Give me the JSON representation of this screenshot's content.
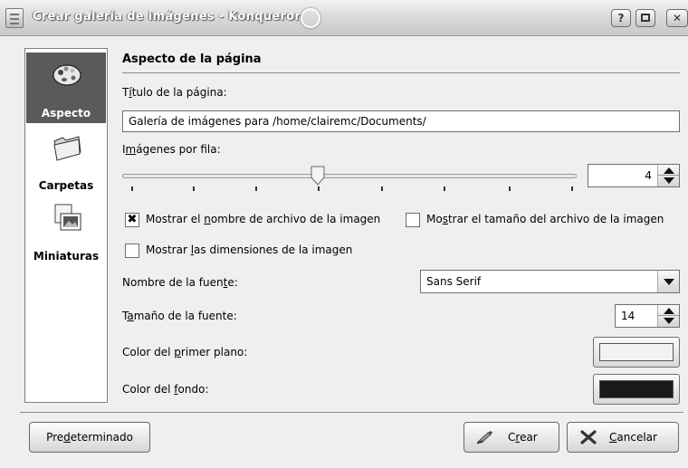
{
  "window": {
    "title": "Crear galería de imágenes - Konqueror",
    "help_label": "?"
  },
  "sidebar": {
    "items": [
      {
        "label": "Aspecto",
        "icon": "palette-icon",
        "active": true
      },
      {
        "label": "Carpetas",
        "icon": "folder-icon",
        "active": false
      },
      {
        "label": "Miniaturas",
        "icon": "thumbnails-icon",
        "active": false
      }
    ]
  },
  "page": {
    "section_title": "Aspecto de la página",
    "title_label_pre": "T",
    "title_label_u": "í",
    "title_label_post": "tulo de la página:",
    "title_value": "Galería de imágenes para /home/clairemc/Documents/",
    "images_label_pre": "I",
    "images_label_u": "m",
    "images_label_post": "ágenes por fila:",
    "images_per_row": "4",
    "images_per_row_fraction": 0.43,
    "show_filename": {
      "pre": "Mostrar el ",
      "u": "n",
      "post": "ombre de archivo de la imagen",
      "checked": true,
      "mark": "✖"
    },
    "show_filesize": {
      "pre": "Mo",
      "u": "s",
      "post": "trar el tamaño del archivo de la imagen",
      "checked": false
    },
    "show_dimensions": {
      "pre": "Mostrar ",
      "u": "l",
      "post": "as dimensiones de la imagen",
      "checked": false
    },
    "font_name_label": {
      "pre": "Nombre de la fuen",
      "u": "t",
      "post": "e:"
    },
    "font_name_value": "Sans Serif",
    "font_size_label": {
      "pre": "T",
      "u": "a",
      "post": "maño de la fuente:"
    },
    "font_size_value": "14",
    "fg_color_label": {
      "pre": "Color del ",
      "u": "p",
      "post": "rimer plano:"
    },
    "fg_color": "#f2f2f2",
    "bg_color_label": {
      "pre": "Color del ",
      "u": "f",
      "post": "ondo:"
    },
    "bg_color": "#1a1a1a"
  },
  "buttons": {
    "defaults": {
      "pre": "Pre",
      "u": "d",
      "post": "eterminado"
    },
    "create": {
      "pre": "C",
      "u": "r",
      "post": "ear"
    },
    "cancel": {
      "pre": "",
      "u": "C",
      "post": "ancelar"
    }
  }
}
